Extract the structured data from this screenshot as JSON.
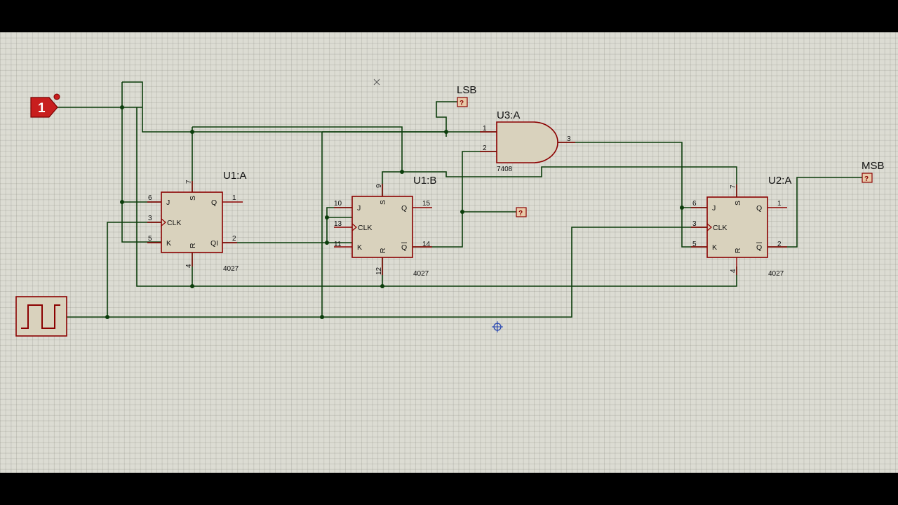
{
  "colors": {
    "wire": "#0b3d0b",
    "component_outline": "#8b0000",
    "component_fill": "#d9d2bd",
    "grid_bg": "#dcdcd3",
    "logic_high": "#c81e1e"
  },
  "components": {
    "u1a": {
      "ref": "U1:A",
      "type": "4027",
      "pin_j": "J",
      "pin_clk": "CLK",
      "pin_k": "K",
      "pin_q": "Q",
      "pin_qbar": "QI",
      "pin_s": "S",
      "pin_r": "R",
      "num_j": "6",
      "num_clk": "3",
      "num_k": "5",
      "num_q": "1",
      "num_qbar": "2",
      "num_s": "7",
      "num_r": "4"
    },
    "u1b": {
      "ref": "U1:B",
      "type": "4027",
      "pin_j": "J",
      "pin_clk": "CLK",
      "pin_k": "K",
      "pin_q": "Q",
      "pin_qbar": "Q",
      "pin_s": "S",
      "pin_r": "R",
      "num_j": "10",
      "num_clk": "13",
      "num_k": "11",
      "num_q": "15",
      "num_qbar": "14",
      "num_s": "9",
      "num_r": "12"
    },
    "u2a": {
      "ref": "U2:A",
      "type": "4027",
      "pin_j": "J",
      "pin_clk": "CLK",
      "pin_k": "K",
      "pin_q": "Q",
      "pin_qbar": "Q",
      "pin_s": "S",
      "pin_r": "R",
      "num_j": "6",
      "num_clk": "3",
      "num_k": "5",
      "num_q": "1",
      "num_qbar": "2",
      "num_s": "7",
      "num_r": "4"
    },
    "u3a": {
      "ref": "U3:A",
      "type": "7408",
      "num_in1": "1",
      "num_in2": "2",
      "num_out": "3"
    }
  },
  "logic_state": {
    "value": "1"
  },
  "probes": {
    "lsb_label": "LSB",
    "msb_label": "MSB",
    "probe_value": "?"
  }
}
